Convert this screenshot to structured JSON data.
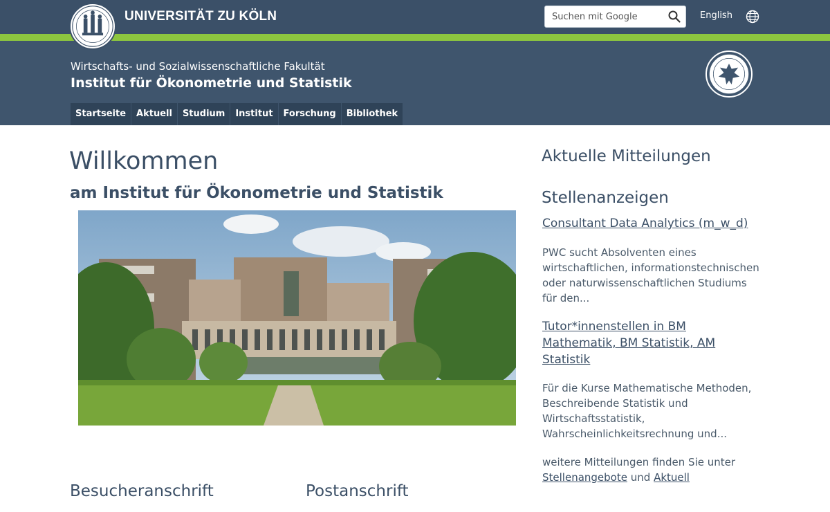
{
  "header": {
    "university": "UNIVERSITÄT ZU KÖLN",
    "search_placeholder": "Suchen mit Google",
    "language": "English",
    "faculty": "Wirtschafts- und Sozialwissenschaftliche Fakultät",
    "institute": "Institut für Ökonometrie und Statistik",
    "icons": [
      "university-seal-icon",
      "search-icon",
      "globe-icon",
      "faculty-seal-icon"
    ]
  },
  "nav": {
    "items": [
      "Startseite",
      "Aktuell",
      "Studium",
      "Institut",
      "Forschung",
      "Bibliothek"
    ]
  },
  "main": {
    "title": "Willkommen",
    "subtitle": "am Institut für Ökonometrie und Statistik",
    "address_visitor": "Besucheranschrift",
    "address_postal": "Postanschrift"
  },
  "sidebar": {
    "news_heading": "Aktuelle Mitteilungen",
    "jobs_heading": "Stellenanzeigen",
    "jobs": [
      {
        "title": "Consultant Data Analytics (m_w_d)",
        "text": "PWC sucht Absolventen eines wirtschaftlichen, informationstechnischen oder naturwissenschaftlichen Studiums für den..."
      },
      {
        "title": "Tutor*innenstellen in BM Mathematik, BM Statistik, AM Statistik",
        "text": "Für die Kurse Mathematische Methoden, Beschreibende Statistik und Wirtschaftsstatistik, Wahrscheinlichkeitsrechnung und..."
      }
    ],
    "more_prefix": "weitere Mitteilungen finden Sie unter",
    "more_link1": "Stellenangebote",
    "more_and": "und",
    "more_link2": "Aktuell"
  },
  "colors": {
    "header_dark": "#3b5068",
    "header": "#3f556d",
    "accent_green": "#8dc63f",
    "heading_text": "#3b4f66"
  }
}
